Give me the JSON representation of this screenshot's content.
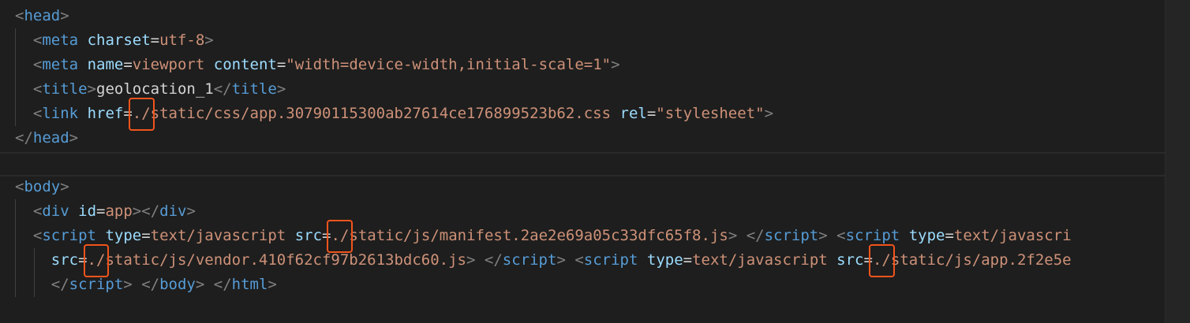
{
  "code": {
    "line1": {
      "open": "<",
      "tag": "head",
      "close": ">"
    },
    "line2": {
      "open": "<",
      "tag": "meta",
      "attr": "charset",
      "eq": "=",
      "value": "utf-8",
      "close": ">"
    },
    "line3": {
      "open": "<",
      "tag": "meta",
      "attr1": "name",
      "eq1": "=",
      "value1": "viewport",
      "attr2": "content",
      "eq2": "=",
      "value2": "\"width=device-width,initial-scale=1\"",
      "close": ">"
    },
    "line4": {
      "open": "<",
      "tag": "title",
      "close": ">",
      "text": "geolocation_1",
      "open2": "</",
      "tag2": "title",
      "close2": ">"
    },
    "line5": {
      "open": "<",
      "tag": "link",
      "attr1": "href",
      "eq1": "=",
      "dotslash": "./",
      "value1_rest": "static/css/app.30790115300ab27614ce176899523b62.css",
      "attr2": "rel",
      "eq2": "=",
      "value2": "\"stylesheet\"",
      "close": ">"
    },
    "line6": {
      "open": "</",
      "tag": "head",
      "close": ">"
    },
    "line8": {
      "open": "<",
      "tag": "body",
      "close": ">"
    },
    "line9": {
      "open": "<",
      "tag": "div",
      "attr": "id",
      "eq": "=",
      "value": "app",
      "close": ">",
      "open2": "</",
      "tag2": "div",
      "close2": ">"
    },
    "line10": {
      "open": "<",
      "tag": "script",
      "attr1": "type",
      "eq1": "=",
      "value1": "text/javascript",
      "attr2": "src",
      "eq2": "=",
      "dotslash": "./",
      "value2_rest": "static/js/manifest.2ae2e69a05c33dfc65f8.js",
      "close": ">",
      "open2": "</",
      "tag2": "script",
      "close2": ">",
      "open3": "<",
      "tag3": "script",
      "attr3": "type",
      "eq3": "=",
      "value3": "text/javascri"
    },
    "line11": {
      "attr1": "src",
      "eq1": "=",
      "dotslash1": "./",
      "value1_rest": "static/js/vendor.410f62cf97b2613bdc60.js",
      "close": ">",
      "open2": "</",
      "tag2": "script",
      "close2": ">",
      "open3": "<",
      "tag3": "script",
      "attr2": "type",
      "eq2": "=",
      "value2": "text/javascript",
      "attr3": "src",
      "eq3": "=",
      "dotslash2": "./",
      "value3_rest": "static/js/app.2f2e5e"
    },
    "line12": {
      "open": "</",
      "tag": "script",
      "close": ">",
      "open2": "</",
      "tag2": "body",
      "close2": ">",
      "open3": "</",
      "tag3": "html",
      "close3": ">"
    }
  },
  "colors": {
    "background": "#1e1e1e",
    "tag": "#569cd6",
    "bracket": "#808080",
    "attribute": "#9cdcfe",
    "string": "#ce9178",
    "highlight_box": "#f2541b"
  }
}
